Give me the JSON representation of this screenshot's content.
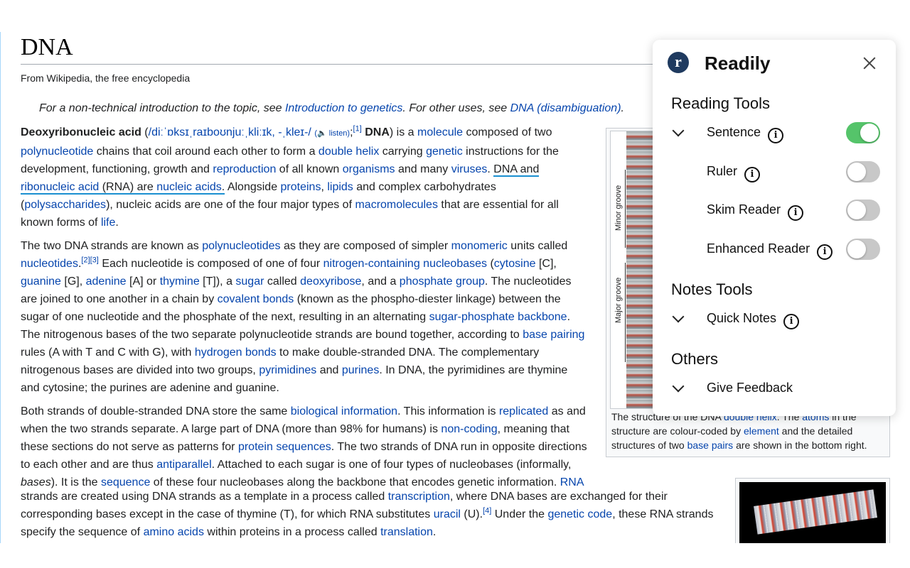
{
  "article": {
    "title": "DNA",
    "tagline": "From Wikipedia, the free encyclopedia",
    "hatnote": {
      "pre": "For a non-technical introduction to the topic, see ",
      "link1": "Introduction to genetics",
      "mid": ". For other uses, see ",
      "link2": "DNA (disambiguation)",
      "post": "."
    }
  },
  "figure": {
    "minor_groove": "Minor groove",
    "major_groove": "Major groove",
    "caption_pre": "The structure of the DNA ",
    "caption_l1": "double helix",
    "caption_m1": ". The ",
    "caption_l2": "atoms",
    "caption_m2": " in the structure are colour-coded by ",
    "caption_l3": "element",
    "caption_m3": " and the detailed structures of two ",
    "caption_l4": "base pairs",
    "caption_post": " are shown in the bottom right."
  },
  "panel": {
    "brand": "Readily",
    "logo_letter": "r",
    "reading_tools": "Reading Tools",
    "notes_tools": "Notes Tools",
    "others": "Others",
    "info_glyph": "i",
    "items": {
      "sentence": {
        "label": "Sentence",
        "enabled": true
      },
      "ruler": {
        "label": "Ruler",
        "enabled": false
      },
      "skim": {
        "label": "Skim Reader",
        "enabled": false
      },
      "enhanced": {
        "label": "Enhanced Reader",
        "enabled": false
      },
      "quick_notes": {
        "label": "Quick Notes"
      },
      "feedback": {
        "label": "Give Feedback"
      }
    },
    "colors": {
      "toggle_on": "#55c46a",
      "toggle_off": "#c8c8c8",
      "logo_bg": "#1f3a5f"
    }
  }
}
